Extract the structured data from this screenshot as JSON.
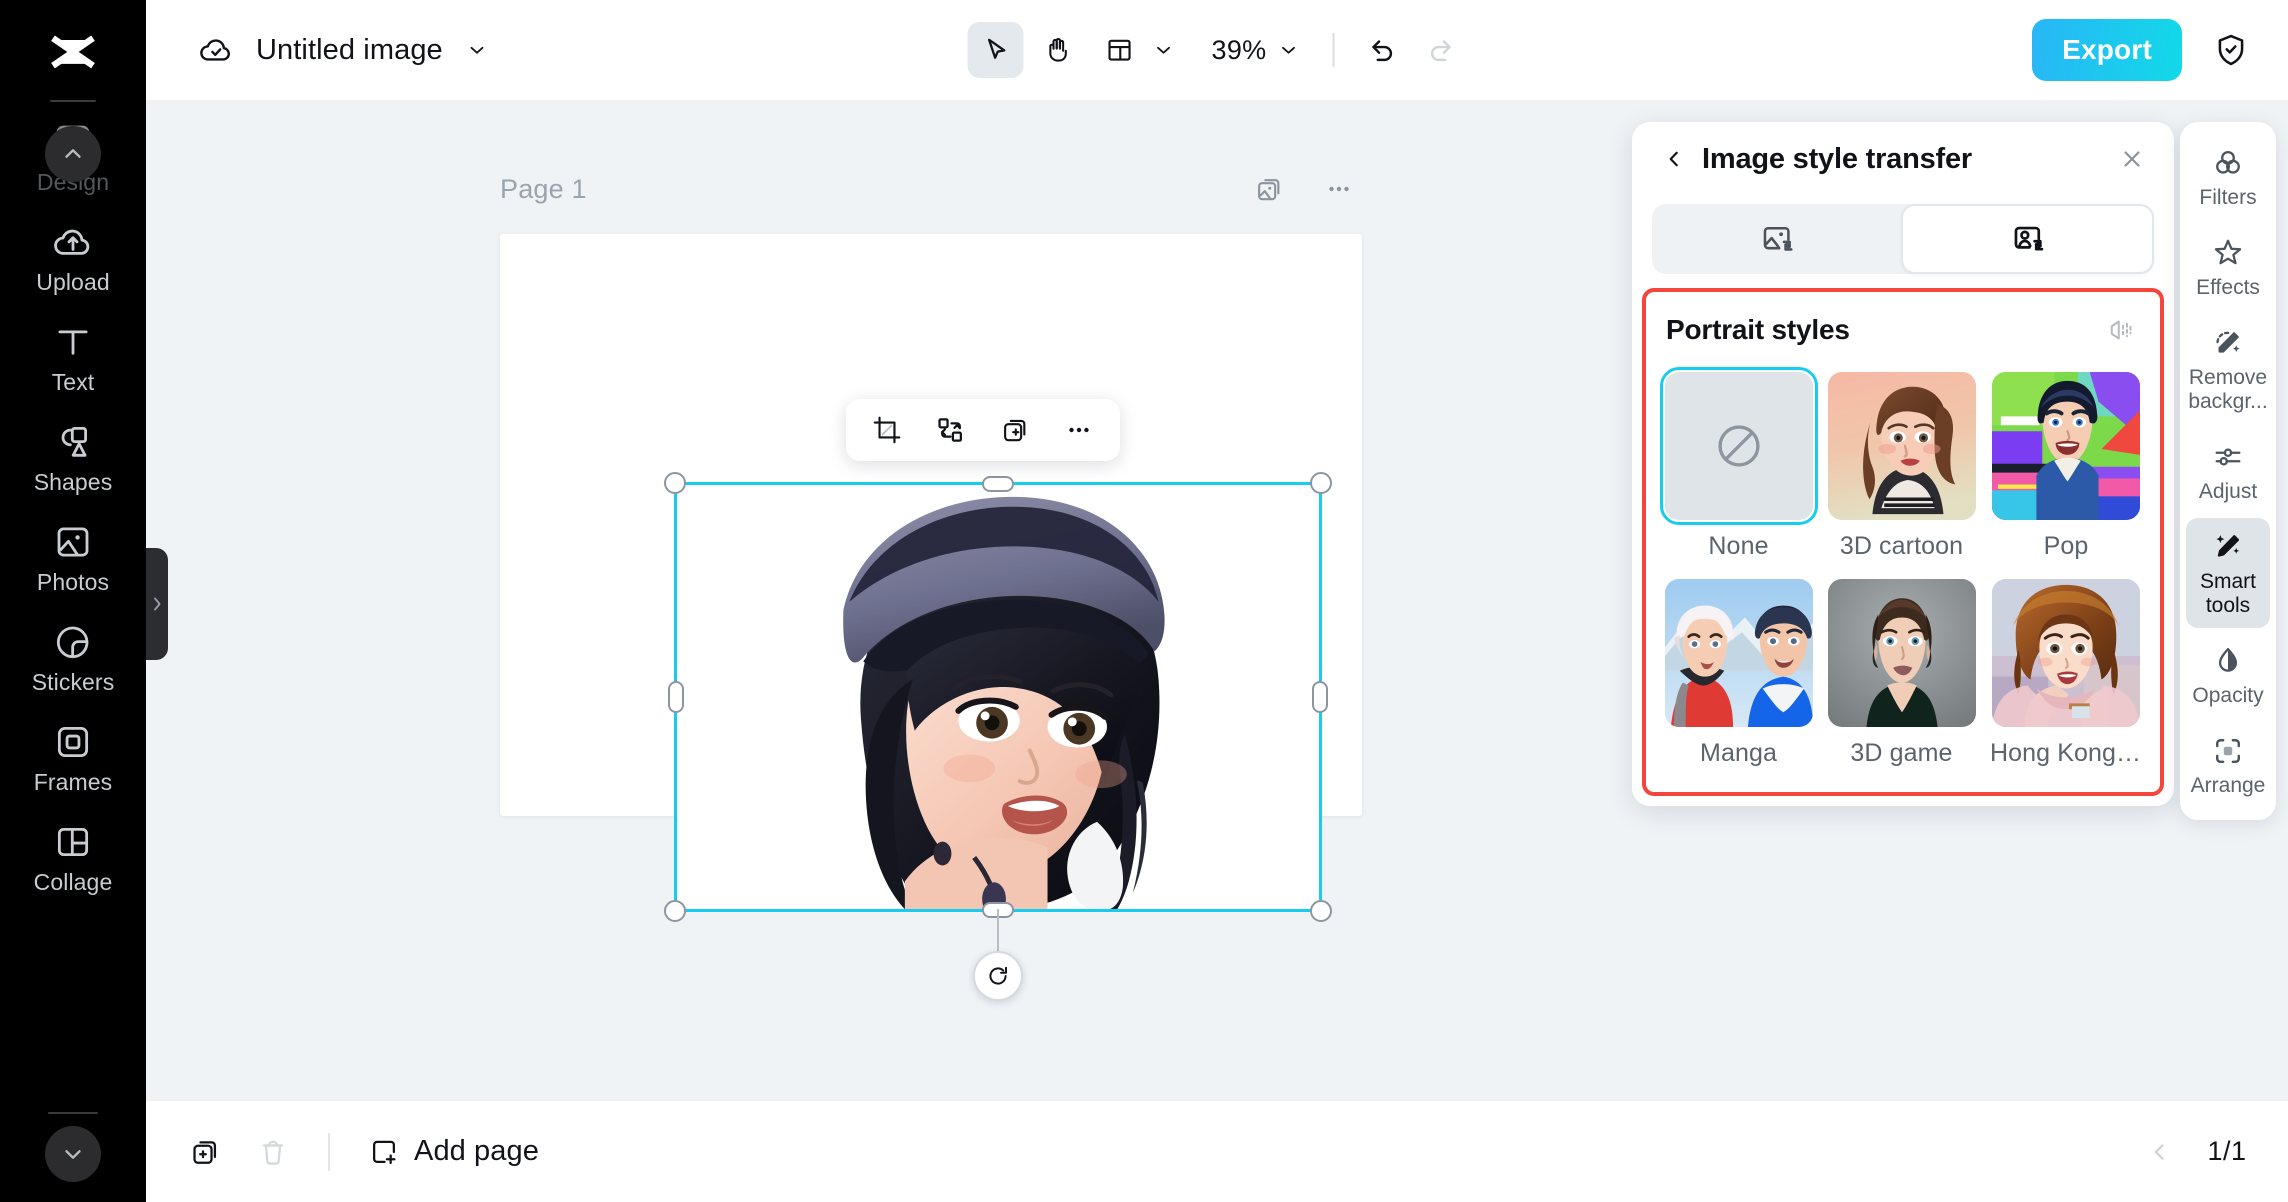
{
  "app": {
    "logo_icon": "capcut-logo-icon"
  },
  "sidebar": {
    "scroll_up_icon": "chevron-up-icon",
    "scroll_down_icon": "chevron-down-icon",
    "expand_handle_icon": "chevron-right-icon",
    "items": [
      {
        "label": "Design",
        "icon": "design-icon",
        "dim": true
      },
      {
        "label": "Upload",
        "icon": "cloud-upload-icon",
        "dim": false
      },
      {
        "label": "Text",
        "icon": "text-icon",
        "dim": false
      },
      {
        "label": "Shapes",
        "icon": "shapes-icon",
        "dim": false
      },
      {
        "label": "Photos",
        "icon": "photo-icon",
        "dim": false
      },
      {
        "label": "Stickers",
        "icon": "sticker-icon",
        "dim": false
      },
      {
        "label": "Frames",
        "icon": "frame-icon",
        "dim": false
      },
      {
        "label": "Collage",
        "icon": "collage-icon",
        "dim": false
      }
    ]
  },
  "topbar": {
    "cloud_status_icon": "cloud-check-icon",
    "document_title": "Untitled image",
    "title_caret_icon": "chevron-down-icon",
    "select_tool_icon": "cursor-arrow-icon",
    "hand_tool_icon": "hand-icon",
    "layout_icon": "layout-grid-icon",
    "layout_caret_icon": "chevron-down-icon",
    "zoom_level": "39%",
    "zoom_caret_icon": "chevron-down-icon",
    "undo_icon": "undo-arrow-icon",
    "redo_icon": "redo-arrow-icon",
    "export_label": "Export",
    "shield_icon": "shield-check-icon"
  },
  "canvas": {
    "page_label": "Page 1",
    "duplicate_page_icon": "duplicate-image-icon",
    "more_icon": "ellipsis-icon",
    "object_toolbar": {
      "crop_icon": "crop-icon",
      "replace_icon": "swap-shapes-icon",
      "duplicate_icon": "duplicate-plus-icon",
      "more_icon": "ellipsis-icon"
    },
    "selection": {
      "border_color": "#16cdf0",
      "rotate_icon": "rotate-icon"
    }
  },
  "panel": {
    "back_icon": "chevron-left-icon",
    "title": "Image style transfer",
    "close_icon": "close-x-icon",
    "modes": [
      {
        "name": "image-style",
        "icon": "image-transfer-icon",
        "active": false
      },
      {
        "name": "portrait-style",
        "icon": "portrait-transfer-icon",
        "active": true
      }
    ],
    "section_title": "Portrait styles",
    "compare_icon": "compare-icon",
    "highlight_color": "#f4463c",
    "selected_color": "#16cdf0",
    "styles": [
      {
        "label": "None",
        "thumb": "none-tile",
        "selected": true
      },
      {
        "label": "3D cartoon",
        "thumb": "thumb-3d-cartoon",
        "selected": false
      },
      {
        "label": "Pop",
        "thumb": "thumb-pop",
        "selected": false
      },
      {
        "label": "Manga",
        "thumb": "thumb-manga",
        "selected": false
      },
      {
        "label": "3D game",
        "thumb": "thumb-3d-game",
        "selected": false
      },
      {
        "label": "Hong Kong ...",
        "thumb": "thumb-hong-kong",
        "selected": false
      }
    ]
  },
  "right_rail": {
    "items": [
      {
        "label": "Filters",
        "icon": "filters-icon",
        "active": false
      },
      {
        "label": "Effects",
        "icon": "effects-star-icon",
        "active": false
      },
      {
        "label": "Remove backgr...",
        "icon": "magic-eraser-icon",
        "active": false
      },
      {
        "label": "Adjust",
        "icon": "sliders-icon",
        "active": false
      },
      {
        "label": "Smart tools",
        "icon": "magic-wand-icon",
        "active": true
      },
      {
        "label": "Opacity",
        "icon": "opacity-drop-icon",
        "active": false
      },
      {
        "label": "Arrange",
        "icon": "arrange-icon",
        "active": false
      }
    ]
  },
  "bottombar": {
    "duplicate_icon": "duplicate-plus-icon",
    "delete_icon": "trash-icon",
    "add_page_icon": "square-plus-icon",
    "add_page_label": "Add page",
    "prev_page_icon": "chevron-left-icon",
    "page_count": "1/1"
  }
}
